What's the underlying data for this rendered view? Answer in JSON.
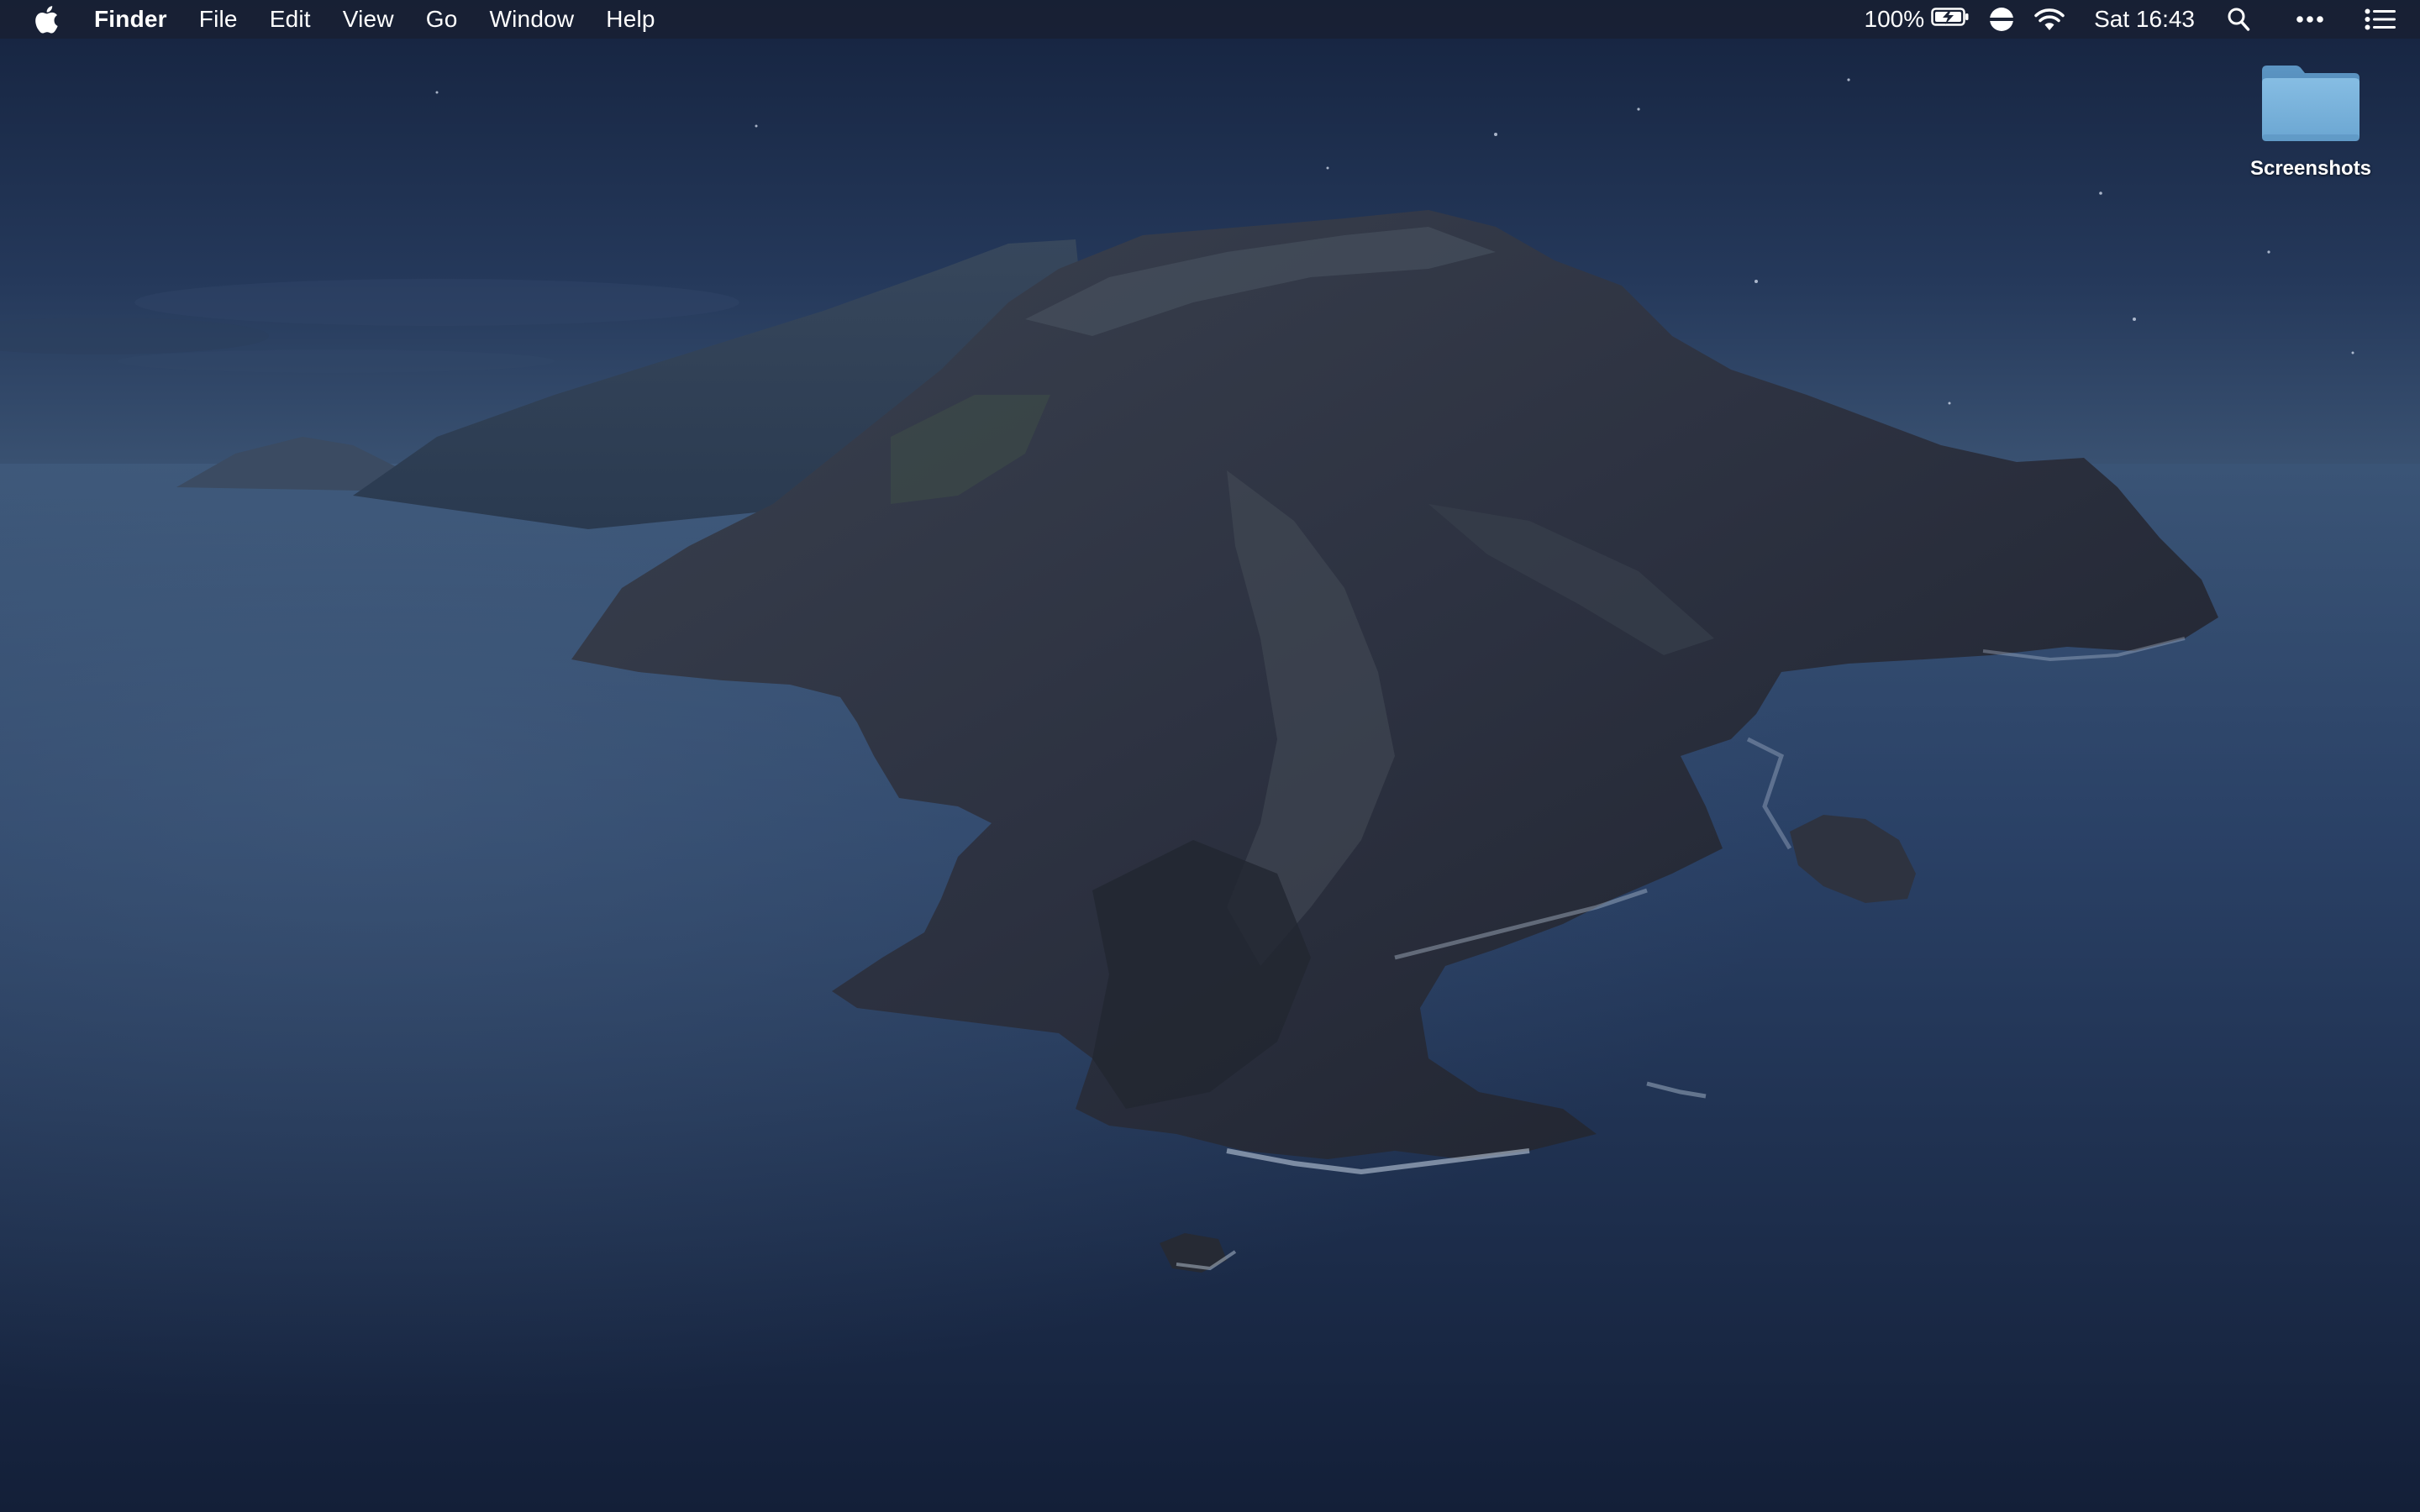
{
  "menubar": {
    "apple_icon": "apple-logo-icon",
    "app_name": "Finder",
    "menus": [
      "File",
      "Edit",
      "View",
      "Go",
      "Window",
      "Help"
    ],
    "battery_percent_text": "100%",
    "battery_icon": "battery-charging-icon",
    "focus_icon": "half-circle-icon",
    "wifi_icon": "wifi-icon",
    "clock": "Sat 16:43",
    "search_icon": "search-icon",
    "more_icon": "ellipsis-icon",
    "notification_icon": "notification-center-icon"
  },
  "desktop": {
    "items": [
      {
        "label": "Screenshots",
        "icon": "folder-icon"
      }
    ]
  },
  "colors": {
    "menubar_bg": "#182032",
    "sky_top": "#18294a",
    "sea": "#243a5e",
    "folder": "#6fa6cf"
  }
}
